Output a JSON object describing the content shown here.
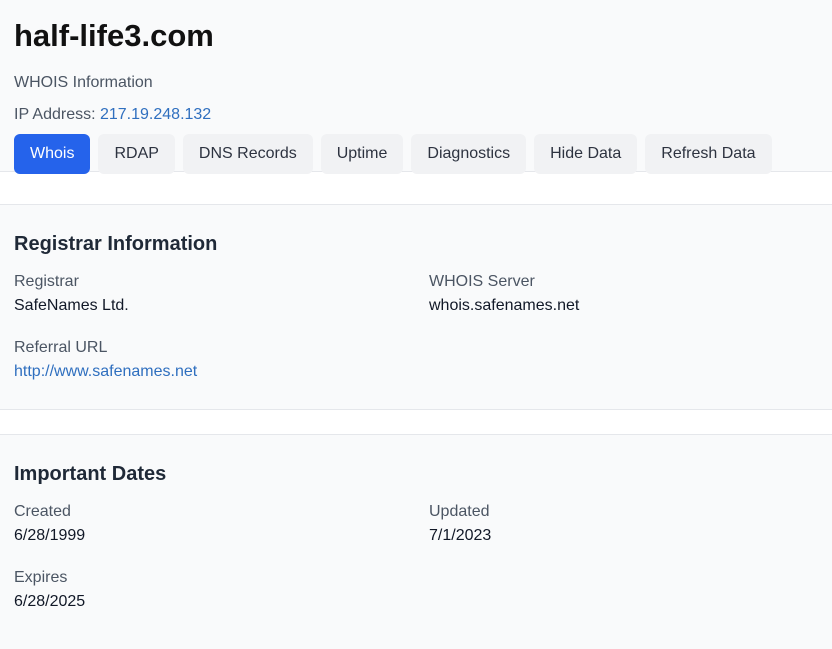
{
  "header": {
    "domain": "half-life3.com",
    "subtitle": "WHOIS Information",
    "ip_label": "IP Address:",
    "ip_value": "217.19.248.132"
  },
  "tabs": [
    {
      "label": "Whois",
      "active": true
    },
    {
      "label": "RDAP",
      "active": false
    },
    {
      "label": "DNS Records",
      "active": false
    },
    {
      "label": "Uptime",
      "active": false
    },
    {
      "label": "Diagnostics",
      "active": false
    },
    {
      "label": "Hide Data",
      "active": false
    },
    {
      "label": "Refresh Data",
      "active": false
    }
  ],
  "registrar_section": {
    "title": "Registrar Information",
    "registrar_label": "Registrar",
    "registrar_value": "SafeNames Ltd.",
    "whois_server_label": "WHOIS Server",
    "whois_server_value": "whois.safenames.net",
    "referral_url_label": "Referral URL",
    "referral_url_value": "http://www.safenames.net"
  },
  "dates_section": {
    "title": "Important Dates",
    "created_label": "Created",
    "created_value": "6/28/1999",
    "updated_label": "Updated",
    "updated_value": "7/1/2023",
    "expires_label": "Expires",
    "expires_value": "6/28/2025"
  },
  "colors": {
    "accent": "#2563eb",
    "link": "#2f6fbf",
    "background": "#f9fafb"
  }
}
